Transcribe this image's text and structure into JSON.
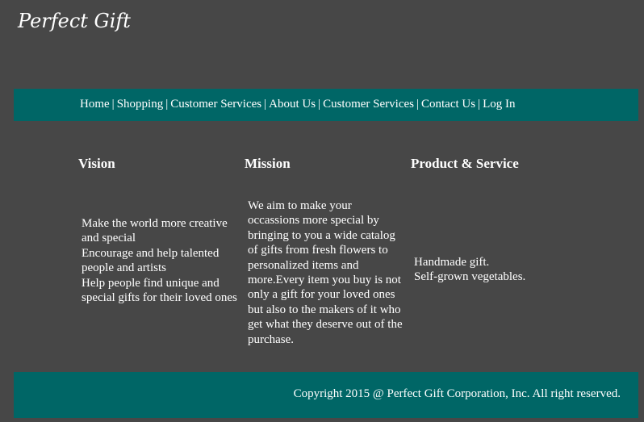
{
  "header": {
    "site_title": "Perfect Gift"
  },
  "nav": {
    "items": [
      {
        "label": "Home"
      },
      {
        "label": "Shopping"
      },
      {
        "label": "Customer Services"
      },
      {
        "label": "About Us"
      },
      {
        "label": "Customer Services"
      },
      {
        "label": "Contact Us"
      },
      {
        "label": "Log In"
      }
    ],
    "separator": "|"
  },
  "vision": {
    "heading": "Vision",
    "lines": [
      "Make the world more creative and special",
      "Encourage and help talented people and artists",
      "Help people find unique and special gifts for their loved ones"
    ]
  },
  "mission": {
    "heading": "Mission",
    "text": "We aim to make your occassions more special by bringing to you a wide catalog of gifts from fresh flowers to personalized items and more.Every item you buy is not only a gift for your loved ones but also to the makers of it who get what they deserve out of the purchase."
  },
  "product_service": {
    "heading": "Product & Service",
    "lines": [
      "Handmade gift.",
      "Self-grown vegetables."
    ]
  },
  "footer": {
    "copyright": "Copyright 2015 @ Perfect Gift Corporation, Inc. All right reserved."
  },
  "colors": {
    "background": "#474747",
    "accent": "#006666",
    "text": "#ffffff"
  }
}
